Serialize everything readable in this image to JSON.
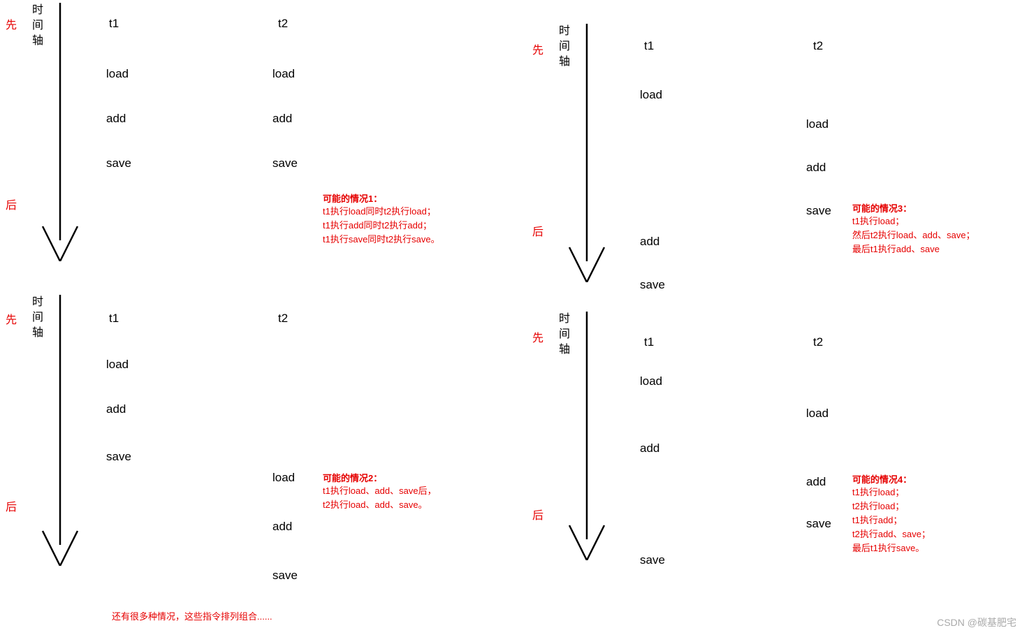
{
  "common": {
    "axis_label_chars": [
      "时",
      "间",
      "轴"
    ],
    "before": "先",
    "after": "后",
    "t1": "t1",
    "t2": "t2",
    "load": "load",
    "add": "add",
    "save": "save"
  },
  "panel1": {
    "t1_ops": [
      "load",
      "add",
      "save"
    ],
    "t2_ops": [
      "load",
      "add",
      "save"
    ],
    "scenario": {
      "title": "可能的情况1：",
      "lines": [
        "t1执行load同时t2执行load；",
        "t1执行add同时t2执行add；",
        "t1执行save同时t2执行save。"
      ]
    }
  },
  "panel2": {
    "t1_ops": [
      "load",
      "add",
      "save"
    ],
    "t2_ops": [
      "load",
      "add",
      "save"
    ],
    "scenario": {
      "title": "可能的情况2：",
      "lines": [
        "t1执行load、add、save后，",
        "t2执行load、add、save。"
      ]
    }
  },
  "panel3": {
    "t1_ops": [
      "load",
      "add",
      "save"
    ],
    "t2_ops": [
      "load",
      "add",
      "save"
    ],
    "scenario": {
      "title": "可能的情况3：",
      "lines": [
        "t1执行load；",
        "然后t2执行load、add、save；",
        "最后t1执行add、save"
      ]
    }
  },
  "panel4": {
    "t1_ops": [
      "load",
      "add",
      "save"
    ],
    "t2_ops": [
      "load",
      "add",
      "save"
    ],
    "scenario": {
      "title": "可能的情况4：",
      "lines": [
        "t1执行load；",
        "t2执行load；",
        "t1执行add；",
        "t2执行add、save；",
        "最后t1执行save。"
      ]
    }
  },
  "footer_note": "还有很多种情况，这些指令排列组合......",
  "watermark": "CSDN @碳基肥宅"
}
